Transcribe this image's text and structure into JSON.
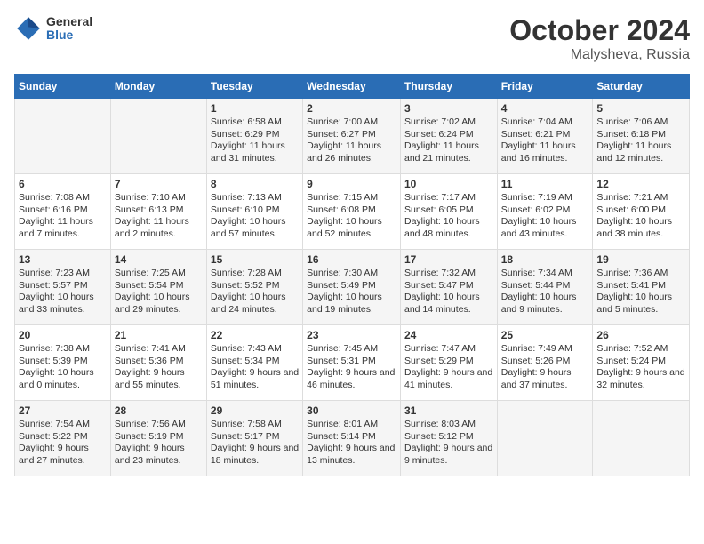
{
  "header": {
    "logo_general": "General",
    "logo_blue": "Blue",
    "month_title": "October 2024",
    "location": "Malysheva, Russia"
  },
  "weekdays": [
    "Sunday",
    "Monday",
    "Tuesday",
    "Wednesday",
    "Thursday",
    "Friday",
    "Saturday"
  ],
  "weeks": [
    [
      {
        "day": "",
        "content": ""
      },
      {
        "day": "",
        "content": ""
      },
      {
        "day": "1",
        "content": "Sunrise: 6:58 AM\nSunset: 6:29 PM\nDaylight: 11 hours and 31 minutes."
      },
      {
        "day": "2",
        "content": "Sunrise: 7:00 AM\nSunset: 6:27 PM\nDaylight: 11 hours and 26 minutes."
      },
      {
        "day": "3",
        "content": "Sunrise: 7:02 AM\nSunset: 6:24 PM\nDaylight: 11 hours and 21 minutes."
      },
      {
        "day": "4",
        "content": "Sunrise: 7:04 AM\nSunset: 6:21 PM\nDaylight: 11 hours and 16 minutes."
      },
      {
        "day": "5",
        "content": "Sunrise: 7:06 AM\nSunset: 6:18 PM\nDaylight: 11 hours and 12 minutes."
      }
    ],
    [
      {
        "day": "6",
        "content": "Sunrise: 7:08 AM\nSunset: 6:16 PM\nDaylight: 11 hours and 7 minutes."
      },
      {
        "day": "7",
        "content": "Sunrise: 7:10 AM\nSunset: 6:13 PM\nDaylight: 11 hours and 2 minutes."
      },
      {
        "day": "8",
        "content": "Sunrise: 7:13 AM\nSunset: 6:10 PM\nDaylight: 10 hours and 57 minutes."
      },
      {
        "day": "9",
        "content": "Sunrise: 7:15 AM\nSunset: 6:08 PM\nDaylight: 10 hours and 52 minutes."
      },
      {
        "day": "10",
        "content": "Sunrise: 7:17 AM\nSunset: 6:05 PM\nDaylight: 10 hours and 48 minutes."
      },
      {
        "day": "11",
        "content": "Sunrise: 7:19 AM\nSunset: 6:02 PM\nDaylight: 10 hours and 43 minutes."
      },
      {
        "day": "12",
        "content": "Sunrise: 7:21 AM\nSunset: 6:00 PM\nDaylight: 10 hours and 38 minutes."
      }
    ],
    [
      {
        "day": "13",
        "content": "Sunrise: 7:23 AM\nSunset: 5:57 PM\nDaylight: 10 hours and 33 minutes."
      },
      {
        "day": "14",
        "content": "Sunrise: 7:25 AM\nSunset: 5:54 PM\nDaylight: 10 hours and 29 minutes."
      },
      {
        "day": "15",
        "content": "Sunrise: 7:28 AM\nSunset: 5:52 PM\nDaylight: 10 hours and 24 minutes."
      },
      {
        "day": "16",
        "content": "Sunrise: 7:30 AM\nSunset: 5:49 PM\nDaylight: 10 hours and 19 minutes."
      },
      {
        "day": "17",
        "content": "Sunrise: 7:32 AM\nSunset: 5:47 PM\nDaylight: 10 hours and 14 minutes."
      },
      {
        "day": "18",
        "content": "Sunrise: 7:34 AM\nSunset: 5:44 PM\nDaylight: 10 hours and 9 minutes."
      },
      {
        "day": "19",
        "content": "Sunrise: 7:36 AM\nSunset: 5:41 PM\nDaylight: 10 hours and 5 minutes."
      }
    ],
    [
      {
        "day": "20",
        "content": "Sunrise: 7:38 AM\nSunset: 5:39 PM\nDaylight: 10 hours and 0 minutes."
      },
      {
        "day": "21",
        "content": "Sunrise: 7:41 AM\nSunset: 5:36 PM\nDaylight: 9 hours and 55 minutes."
      },
      {
        "day": "22",
        "content": "Sunrise: 7:43 AM\nSunset: 5:34 PM\nDaylight: 9 hours and 51 minutes."
      },
      {
        "day": "23",
        "content": "Sunrise: 7:45 AM\nSunset: 5:31 PM\nDaylight: 9 hours and 46 minutes."
      },
      {
        "day": "24",
        "content": "Sunrise: 7:47 AM\nSunset: 5:29 PM\nDaylight: 9 hours and 41 minutes."
      },
      {
        "day": "25",
        "content": "Sunrise: 7:49 AM\nSunset: 5:26 PM\nDaylight: 9 hours and 37 minutes."
      },
      {
        "day": "26",
        "content": "Sunrise: 7:52 AM\nSunset: 5:24 PM\nDaylight: 9 hours and 32 minutes."
      }
    ],
    [
      {
        "day": "27",
        "content": "Sunrise: 7:54 AM\nSunset: 5:22 PM\nDaylight: 9 hours and 27 minutes."
      },
      {
        "day": "28",
        "content": "Sunrise: 7:56 AM\nSunset: 5:19 PM\nDaylight: 9 hours and 23 minutes."
      },
      {
        "day": "29",
        "content": "Sunrise: 7:58 AM\nSunset: 5:17 PM\nDaylight: 9 hours and 18 minutes."
      },
      {
        "day": "30",
        "content": "Sunrise: 8:01 AM\nSunset: 5:14 PM\nDaylight: 9 hours and 13 minutes."
      },
      {
        "day": "31",
        "content": "Sunrise: 8:03 AM\nSunset: 5:12 PM\nDaylight: 9 hours and 9 minutes."
      },
      {
        "day": "",
        "content": ""
      },
      {
        "day": "",
        "content": ""
      }
    ]
  ]
}
